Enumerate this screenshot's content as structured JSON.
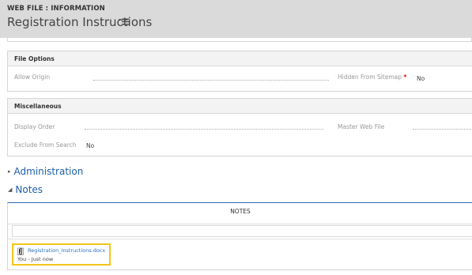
{
  "header": {
    "entity_label": "WEB FILE : INFORMATION",
    "record_title": "Registration Instructions"
  },
  "sections": {
    "file_options": {
      "title": "File Options",
      "allow_origin_label": "Allow Origin",
      "hidden_from_sitemap_label": "Hidden From Sitemap",
      "required_marker": "*",
      "hidden_from_sitemap_value": "No"
    },
    "miscellaneous": {
      "title": "Miscellaneous",
      "display_order_label": "Display Order",
      "master_web_file_label": "Master Web File",
      "exclude_from_search_label": "Exclude From Search",
      "exclude_from_search_value": "No"
    }
  },
  "administration": {
    "label": "Administration",
    "arrow": "▸"
  },
  "notes": {
    "label": "Notes",
    "arrow": "◢",
    "panel_title": "NOTES",
    "items": [
      {
        "attachment": "Registration_Instructions.docx",
        "author": "You",
        "separator": "-",
        "time": "Just now"
      }
    ]
  },
  "colors": {
    "link": "#1d5ea8",
    "highlight": "#f5c518",
    "header_bg": "#dadada"
  }
}
